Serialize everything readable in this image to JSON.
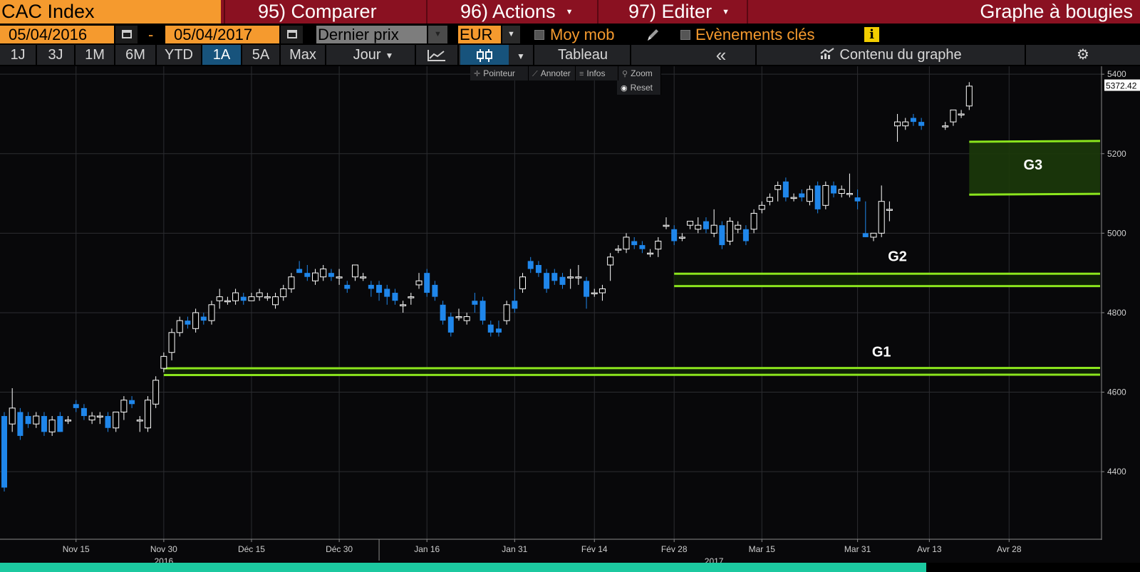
{
  "header": {
    "ticker": "CAC Index",
    "menu": [
      {
        "label": "95) Comparer",
        "caret": false
      },
      {
        "label": "96) Actions",
        "caret": true
      },
      {
        "label": "97) Editer",
        "caret": true
      }
    ],
    "chart_type": "Graphe à bougies",
    "colors": {
      "title_bar": "#8a1121",
      "accent": "#f59a2e"
    }
  },
  "settings": {
    "start_date": "05/04/2016",
    "dash": "-",
    "end_date": "05/04/2017",
    "price_field": "Dernier prix",
    "currency": "EUR",
    "moving_avg_label": "Moy mob",
    "moving_avg_checked": false,
    "key_events_label": "Evènements clés",
    "key_events_checked": false,
    "info_icon": "i"
  },
  "toolbar": {
    "ranges": [
      "1J",
      "3J",
      "1M",
      "6M",
      "YTD",
      "1A",
      "5A",
      "Max"
    ],
    "active_range": "1A",
    "period": "Jour",
    "table_label": "Tableau",
    "collapse_label": "«",
    "content_label": "Contenu du graphe"
  },
  "chart_tools": {
    "pointer": "Pointeur",
    "annotate": "Annoter",
    "info": "Infos",
    "zoom": "Zoom",
    "reset": "Reset"
  },
  "chart_data": {
    "type": "candlestick",
    "title": "",
    "xlabel": "",
    "ylabel": "",
    "ylim": [
      4230,
      5420
    ],
    "y_ticks": [
      4400,
      4600,
      4800,
      5000,
      5200,
      5400
    ],
    "last_price": "5372.42",
    "x_ticks": [
      {
        "label": "Nov 15",
        "day": 9
      },
      {
        "label": "Nov 30",
        "day": 20
      },
      {
        "label": "Déc 15",
        "day": 31
      },
      {
        "label": "Déc 30",
        "day": 42
      },
      {
        "label": "Jan 16",
        "day": 53
      },
      {
        "label": "Jan 31",
        "day": 64
      },
      {
        "label": "Fév 14",
        "day": 74
      },
      {
        "label": "Fév 28",
        "day": 84
      },
      {
        "label": "Mar 15",
        "day": 95
      },
      {
        "label": "Mar 31",
        "day": 107
      },
      {
        "label": "Avr 13",
        "day": 116
      },
      {
        "label": "Avr 28",
        "day": 126
      }
    ],
    "year_labels": [
      {
        "label": "2016",
        "day": 20
      },
      {
        "label": "2017",
        "day": 89
      }
    ],
    "year_separator_day": 47,
    "day_range": [
      0,
      135
    ],
    "zones": [
      {
        "name": "G1",
        "start_day": 20,
        "y1_start": 4660,
        "y2_start": 4643,
        "y1_end": 4661,
        "y2_end": 4644,
        "label_day": 110,
        "label_y": 4690,
        "filled": false
      },
      {
        "name": "G2",
        "start_day": 84,
        "y1_start": 4898,
        "y2_start": 4867,
        "y1_end": 4898,
        "y2_end": 4867,
        "label_day": 112,
        "label_y": 4930,
        "filled": false
      },
      {
        "name": "G3",
        "start_day": 121,
        "y1_start": 5230,
        "y2_start": 5097,
        "y1_end": 5232,
        "y2_end": 5099,
        "label_day": 129,
        "label_y": 5160,
        "filled": true
      }
    ],
    "colors": {
      "up": "#ffffff",
      "down": "#1f86ea",
      "zone": "#8be51d",
      "grid": "#2c2d31",
      "axis_text": "#cfcfcf"
    },
    "candles": [
      [
        4540,
        4550,
        4350,
        4360
      ],
      [
        4520,
        4610,
        4500,
        4560
      ],
      [
        4550,
        4560,
        4480,
        4490
      ],
      [
        4540,
        4550,
        4510,
        4520
      ],
      [
        4520,
        4550,
        4510,
        4540
      ],
      [
        4540,
        4550,
        4490,
        4500
      ],
      [
        4500,
        4540,
        4490,
        4530
      ],
      [
        4540,
        4550,
        4500,
        4500
      ],
      [
        4530,
        4540,
        4520,
        4530
      ],
      [
        4570,
        4580,
        4550,
        4560
      ],
      [
        4560,
        4570,
        4530,
        4540
      ],
      [
        4530,
        4550,
        4520,
        4540
      ],
      [
        4540,
        4550,
        4520,
        4540
      ],
      [
        4540,
        4550,
        4500,
        4510
      ],
      [
        4510,
        4550,
        4500,
        4550
      ],
      [
        4550,
        4590,
        4530,
        4580
      ],
      [
        4580,
        4590,
        4560,
        4570
      ],
      [
        4530,
        4540,
        4500,
        4530
      ],
      [
        4510,
        4590,
        4500,
        4580
      ],
      [
        4570,
        4640,
        4560,
        4630
      ],
      [
        4660,
        4700,
        4650,
        4690
      ],
      [
        4700,
        4760,
        4680,
        4750
      ],
      [
        4750,
        4790,
        4740,
        4780
      ],
      [
        4780,
        4790,
        4760,
        4770
      ],
      [
        4760,
        4810,
        4750,
        4800
      ],
      [
        4790,
        4800,
        4770,
        4780
      ],
      [
        4780,
        4830,
        4770,
        4820
      ],
      [
        4830,
        4860,
        4810,
        4840
      ],
      [
        4830,
        4840,
        4820,
        4830
      ],
      [
        4830,
        4860,
        4820,
        4850
      ],
      [
        4840,
        4850,
        4820,
        4830
      ],
      [
        4830,
        4850,
        4830,
        4840
      ],
      [
        4840,
        4860,
        4830,
        4850
      ],
      [
        4840,
        4850,
        4830,
        4840
      ],
      [
        4820,
        4850,
        4810,
        4840
      ],
      [
        4840,
        4870,
        4830,
        4860
      ],
      [
        4860,
        4900,
        4850,
        4890
      ],
      [
        4910,
        4930,
        4900,
        4900
      ],
      [
        4900,
        4920,
        4880,
        4890
      ],
      [
        4880,
        4910,
        4870,
        4900
      ],
      [
        4890,
        4920,
        4880,
        4910
      ],
      [
        4900,
        4910,
        4880,
        4890
      ],
      [
        4890,
        4910,
        4870,
        4890
      ],
      [
        4870,
        4880,
        4850,
        4860
      ],
      [
        4890,
        4920,
        4880,
        4920
      ],
      [
        4890,
        4900,
        4880,
        4890
      ],
      [
        4870,
        4880,
        4840,
        4860
      ],
      [
        4870,
        4880,
        4830,
        4850
      ],
      [
        4860,
        4870,
        4820,
        4840
      ],
      [
        4850,
        4860,
        4820,
        4830
      ],
      [
        4820,
        4830,
        4800,
        4820
      ],
      [
        4840,
        4850,
        4820,
        4840
      ],
      [
        4870,
        4900,
        4860,
        4880
      ],
      [
        4900,
        4910,
        4840,
        4850
      ],
      [
        4870,
        4880,
        4830,
        4840
      ],
      [
        4820,
        4830,
        4770,
        4780
      ],
      [
        4790,
        4800,
        4740,
        4750
      ],
      [
        4790,
        4810,
        4780,
        4790
      ],
      [
        4780,
        4800,
        4770,
        4790
      ],
      [
        4830,
        4850,
        4800,
        4820
      ],
      [
        4830,
        4840,
        4770,
        4780
      ],
      [
        4770,
        4780,
        4740,
        4750
      ],
      [
        4760,
        4780,
        4740,
        4750
      ],
      [
        4780,
        4830,
        4770,
        4820
      ],
      [
        4830,
        4860,
        4800,
        4810
      ],
      [
        4860,
        4900,
        4850,
        4890
      ],
      [
        4930,
        4940,
        4900,
        4910
      ],
      [
        4920,
        4930,
        4890,
        4900
      ],
      [
        4900,
        4910,
        4850,
        4860
      ],
      [
        4900,
        4910,
        4870,
        4880
      ],
      [
        4890,
        4900,
        4860,
        4870
      ],
      [
        4890,
        4910,
        4860,
        4890
      ],
      [
        4890,
        4920,
        4870,
        4890
      ],
      [
        4880,
        4890,
        4810,
        4840
      ],
      [
        4850,
        4860,
        4840,
        4850
      ],
      [
        4850,
        4870,
        4830,
        4860
      ],
      [
        4920,
        4950,
        4880,
        4940
      ],
      [
        4960,
        4970,
        4950,
        4960
      ],
      [
        4960,
        5000,
        4950,
        4990
      ],
      [
        4980,
        4990,
        4960,
        4970
      ],
      [
        4970,
        4980,
        4950,
        4960
      ],
      [
        4950,
        4960,
        4940,
        4950
      ],
      [
        4960,
        4990,
        4940,
        4980
      ],
      [
        5020,
        5040,
        5010,
        5020
      ],
      [
        5010,
        5020,
        4970,
        4980
      ],
      [
        4990,
        5000,
        4980,
        4990
      ],
      [
        5020,
        5030,
        5010,
        5030
      ],
      [
        5010,
        5040,
        5000,
        5020
      ],
      [
        5030,
        5040,
        5000,
        5010
      ],
      [
        5000,
        5060,
        4990,
        5020
      ],
      [
        5020,
        5030,
        4960,
        4970
      ],
      [
        4980,
        5040,
        4970,
        5030
      ],
      [
        5010,
        5030,
        5000,
        5020
      ],
      [
        5010,
        5020,
        4970,
        4980
      ],
      [
        5010,
        5060,
        5000,
        5050
      ],
      [
        5060,
        5080,
        5050,
        5070
      ],
      [
        5080,
        5100,
        5070,
        5090
      ],
      [
        5110,
        5130,
        5080,
        5120
      ],
      [
        5130,
        5140,
        5080,
        5090
      ],
      [
        5090,
        5100,
        5080,
        5090
      ],
      [
        5100,
        5110,
        5080,
        5090
      ],
      [
        5080,
        5120,
        5070,
        5110
      ],
      [
        5120,
        5130,
        5050,
        5060
      ],
      [
        5070,
        5130,
        5060,
        5120
      ],
      [
        5120,
        5130,
        5090,
        5100
      ],
      [
        5100,
        5120,
        5090,
        5110
      ],
      [
        5100,
        5150,
        5090,
        5100
      ],
      [
        5090,
        5110,
        5060,
        5080
      ],
      [
        5000,
        5080,
        4990,
        4990
      ],
      [
        4990,
        5000,
        4980,
        5000
      ],
      [
        5000,
        5120,
        4990,
        5080
      ],
      [
        5060,
        5080,
        5030,
        5060
      ],
      [
        5270,
        5300,
        5230,
        5280
      ],
      [
        5270,
        5290,
        5260,
        5280
      ],
      [
        5290,
        5300,
        5270,
        5280
      ],
      [
        5280,
        5290,
        5260,
        5270
      ],
      [
        5270,
        5280,
        5260,
        5270
      ],
      [
        5280,
        5310,
        5270,
        5310
      ],
      [
        5300,
        5310,
        5290,
        5300
      ],
      [
        5320,
        5380,
        5310,
        5370
      ]
    ],
    "candle_days": [
      0,
      1,
      2,
      3,
      4,
      5,
      6,
      7,
      8,
      9,
      10,
      11,
      12,
      13,
      14,
      15,
      16,
      17,
      18,
      19,
      20,
      21,
      22,
      23,
      24,
      25,
      26,
      27,
      28,
      29,
      30,
      31,
      32,
      33,
      34,
      35,
      36,
      37,
      38,
      39,
      40,
      41,
      42,
      43,
      44,
      45,
      46,
      47,
      48,
      49,
      50,
      51,
      52,
      53,
      54,
      55,
      56,
      57,
      58,
      59,
      60,
      61,
      62,
      63,
      64,
      65,
      66,
      67,
      68,
      69,
      70,
      71,
      72,
      73,
      74,
      75,
      76,
      77,
      78,
      79,
      80,
      81,
      82,
      83,
      84,
      85,
      86,
      87,
      88,
      89,
      90,
      91,
      92,
      93,
      94,
      95,
      96,
      97,
      98,
      99,
      100,
      101,
      102,
      103,
      104,
      105,
      106,
      107,
      108,
      109,
      110,
      111,
      112,
      113,
      114,
      115,
      118,
      119,
      120,
      121,
      122,
      123,
      124,
      125,
      126,
      127,
      128,
      129
    ]
  }
}
